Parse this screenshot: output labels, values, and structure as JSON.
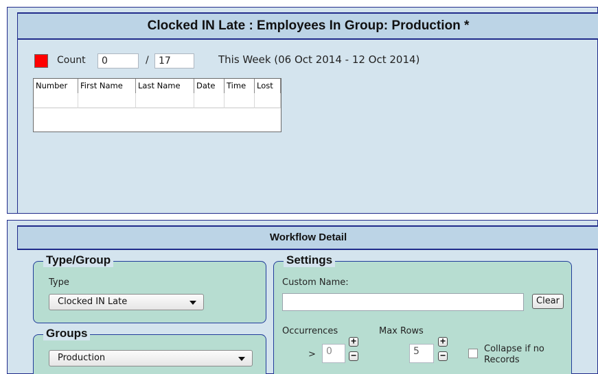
{
  "top_panel": {
    "title": "Clocked IN Late : Employees In Group: Production *",
    "count_label": "Count",
    "count_value": "0",
    "total_value": "/ 17",
    "period_text": "This Week (06 Oct 2014 - 12 Oct 2014)",
    "status_color": "#ff0000",
    "table": {
      "columns": [
        "Number",
        "First Name",
        "Last Name",
        "Date",
        "Time",
        "Lost"
      ]
    }
  },
  "workflow": {
    "title": "Workflow Detail",
    "type_group": {
      "title": "Type/Group",
      "type_label": "Type",
      "type_value": "Clocked IN Late"
    },
    "groups": {
      "title": "Groups",
      "value": "Production"
    },
    "settings": {
      "title": "Settings",
      "custom_name_label": "Custom Name:",
      "custom_name_value": "",
      "clear_label": "Clear",
      "occurrences_label": "Occurrences",
      "occurrences_op": ">",
      "occurrences_value": "0",
      "max_rows_label": "Max Rows",
      "max_rows_value": "5",
      "plus": "+",
      "minus": "−",
      "collapse_label_1": "Collapse if no",
      "collapse_label_2": "Records"
    }
  }
}
